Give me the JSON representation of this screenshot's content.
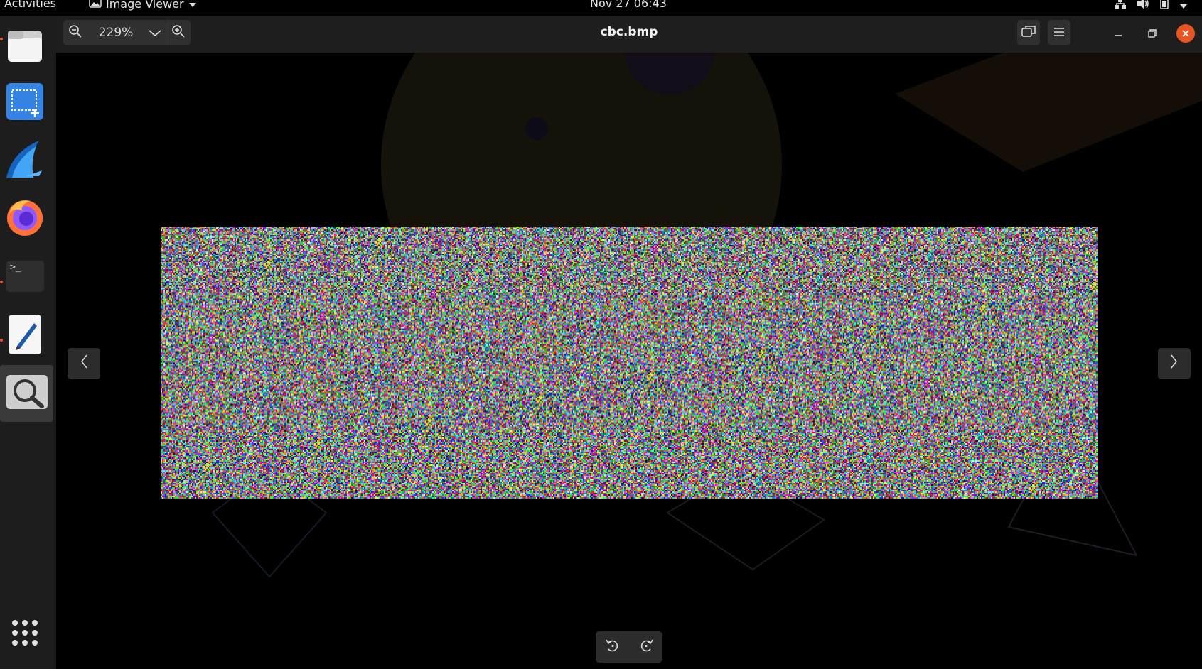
{
  "topbar": {
    "activities": "Activities",
    "app_name": "Image Viewer",
    "clock": "Nov 27  06:43"
  },
  "dock": {
    "items": [
      {
        "name": "Files",
        "icon": "files-icon"
      },
      {
        "name": "Screenshot",
        "icon": "screenshot-icon"
      },
      {
        "name": "Wireshark",
        "icon": "wireshark-icon"
      },
      {
        "name": "Firefox",
        "icon": "firefox-icon"
      },
      {
        "name": "Terminal",
        "icon": "terminal-icon"
      },
      {
        "name": "Text Editor",
        "icon": "text-editor-icon"
      },
      {
        "name": "Image Viewer",
        "icon": "image-viewer-icon"
      }
    ],
    "show_apps_icon": "app-grid-icon"
  },
  "viewer": {
    "zoom": "229%",
    "title": "cbc.bmp",
    "terminal_prompt": ">_"
  },
  "colors": {
    "accent": "#e95420",
    "headerbar": "#1e1e1e",
    "dock": "#1d1d1d"
  }
}
